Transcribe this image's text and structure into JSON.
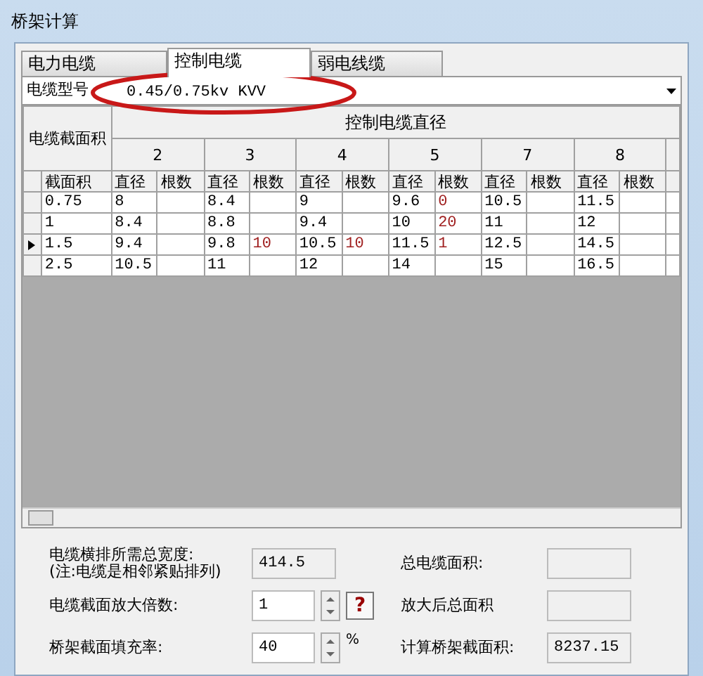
{
  "window": {
    "title": "桥架计算"
  },
  "tabs": [
    {
      "label": "电力电缆",
      "selected": false
    },
    {
      "label": "控制电缆",
      "selected": true
    },
    {
      "label": "弱电线缆",
      "selected": false
    }
  ],
  "cable_type": {
    "label": "电缆型号",
    "value": "0.45/0.75kv KVV"
  },
  "table": {
    "corner": "电缆截面积",
    "title": "控制电缆直径",
    "groups": [
      "2",
      "3",
      "4",
      "5",
      "7",
      "8"
    ],
    "columns": [
      "截面积",
      "直径",
      "根数",
      "直径",
      "根数",
      "直径",
      "根数",
      "直径",
      "根数",
      "直径",
      "根数",
      "直径",
      "根数"
    ],
    "rows": [
      {
        "current": false,
        "cells": [
          "0.75",
          "8",
          "",
          "8.4",
          "",
          "9",
          "",
          "9.6",
          "0",
          "10.5",
          "",
          "11.5",
          ""
        ]
      },
      {
        "current": false,
        "cells": [
          "1",
          "8.4",
          "",
          "8.8",
          "",
          "9.4",
          "",
          "10",
          "20",
          "11",
          "",
          "12",
          ""
        ]
      },
      {
        "current": true,
        "cells": [
          "1.5",
          "9.4",
          "",
          "9.8",
          "10",
          "10.5",
          "10",
          "11.5",
          "1",
          "12.5",
          "",
          "14.5",
          ""
        ]
      },
      {
        "current": false,
        "cells": [
          "2.5",
          "10.5",
          "",
          "11",
          "",
          "12",
          "",
          "14",
          "",
          "15",
          "",
          "16.5",
          ""
        ]
      }
    ]
  },
  "form": {
    "left": [
      {
        "label": "电缆横排所需总宽度:",
        "note": "(注:电缆是相邻紧贴排列)",
        "value": "414.5",
        "kind": "readonly"
      },
      {
        "label": "电缆截面放大倍数:",
        "value": "1",
        "kind": "spin",
        "help": "?"
      },
      {
        "label": "桥架截面填充率:",
        "value": "40",
        "kind": "spin",
        "unit": "%"
      }
    ],
    "right": [
      {
        "label": "总电缆面积:",
        "kind": "readonly"
      },
      {
        "label": "放大后总面积",
        "kind": "readonly"
      },
      {
        "label": "计算桥架截面积:",
        "value": "8237.15",
        "kind": "readonly"
      }
    ]
  }
}
